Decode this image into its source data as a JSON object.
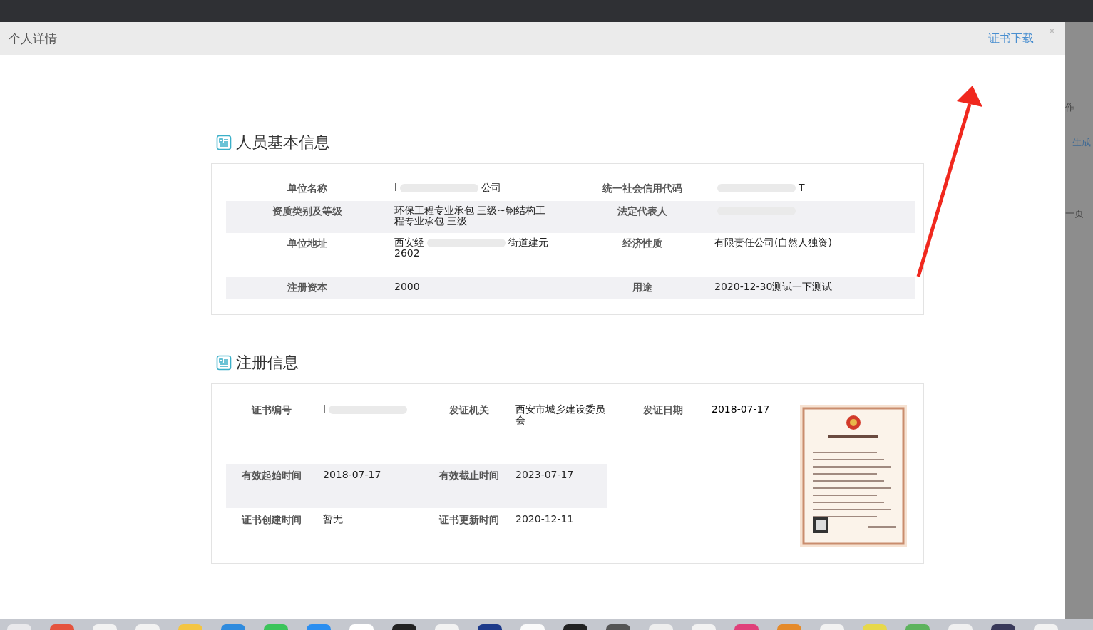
{
  "dialog": {
    "title": "个人详情",
    "download_link": "证书下载",
    "close": "×"
  },
  "basic_info": {
    "title": "人员基本信息",
    "rows": [
      {
        "cells": [
          {
            "label": "单位名称",
            "value": [
              {
                "kind": "text",
                "text": "l"
              },
              {
                "kind": "redacted"
              },
              {
                "kind": "text",
                "text": "公司"
              }
            ]
          },
          {
            "label": "统一社会信用代码",
            "value": [
              {
                "kind": "redacted"
              },
              {
                "kind": "text",
                "text": "T"
              }
            ]
          }
        ]
      },
      {
        "cells": [
          {
            "label": "资质类别及等级",
            "value": [
              {
                "kind": "text",
                "text": "环保工程专业承包 三级~钢结构工程专业承包 三级"
              }
            ]
          },
          {
            "label": "法定代表人",
            "value": [
              {
                "kind": "redacted"
              }
            ]
          }
        ]
      },
      {
        "cells": [
          {
            "label": "单位地址",
            "value": [
              {
                "kind": "text",
                "text": "西安经"
              },
              {
                "kind": "redacted"
              },
              {
                "kind": "text",
                "text": "街道建元"
              },
              {
                "kind": "text",
                "text": "2602"
              }
            ]
          },
          {
            "label": "经济性质",
            "value": [
              {
                "kind": "text",
                "text": "有限责任公司(自然人独资)"
              }
            ]
          }
        ]
      },
      {
        "cells": [
          {
            "label": "注册资本",
            "value": [
              {
                "kind": "text",
                "text": "2000"
              }
            ]
          },
          {
            "label": "用途",
            "value": [
              {
                "kind": "text",
                "text": "2020-12-30测试一下测试"
              }
            ]
          }
        ]
      }
    ]
  },
  "registration": {
    "title": "注册信息",
    "rows": [
      {
        "cells": [
          {
            "label": "证书编号",
            "value": [
              {
                "kind": "text",
                "text": "l"
              },
              {
                "kind": "redacted"
              }
            ]
          },
          {
            "label": "发证机关",
            "value": [
              {
                "kind": "text",
                "text": "西安市城乡建设委员会"
              }
            ]
          },
          {
            "label": "发证日期",
            "value": [
              {
                "kind": "text",
                "text": "2018-07-17"
              }
            ]
          }
        ]
      },
      {
        "cells": [
          {
            "label": "有效起始时间",
            "value": [
              {
                "kind": "text",
                "text": "2018-07-17"
              }
            ]
          },
          {
            "label": "有效截止时间",
            "value": [
              {
                "kind": "text",
                "text": "2023-07-17"
              }
            ]
          }
        ]
      },
      {
        "cells": [
          {
            "label": "证书创建时间",
            "value": [
              {
                "kind": "text",
                "text": "暂无"
              }
            ]
          },
          {
            "label": "证书更新时间",
            "value": [
              {
                "kind": "text",
                "text": "2020-12-11"
              }
            ]
          }
        ]
      }
    ]
  },
  "background_page": {
    "texts": [
      "作",
      "生成",
      "一页"
    ]
  }
}
